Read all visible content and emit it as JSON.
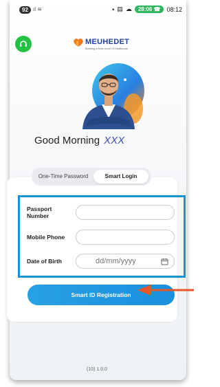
{
  "status_bar": {
    "badge": "92",
    "signal": "ıl ≋",
    "call_timer": "28:06 ☎",
    "time": "08:12"
  },
  "app": {
    "brand": "MEUHEDET",
    "tagline": "Building a New Level of Healthcare"
  },
  "greeting": {
    "text": "Good Morning",
    "name": "XXX"
  },
  "tabs": [
    {
      "label": "One-Time Password"
    },
    {
      "label": "Smart Login"
    }
  ],
  "form": {
    "passport_label": "Passport Number",
    "mobile_label": "Mobile Phone",
    "dob_label": "Date of Birth",
    "dob_placeholder": "dd/mm/yyyy"
  },
  "cta": {
    "label": "Smart ID Registration"
  },
  "version": "(10) 1.0.0",
  "colors": {
    "brand_blue": "#1f3fa4",
    "accent": "#1a8fd6",
    "support_green": "#23c244",
    "highlight_arrow": "#e8562a"
  }
}
